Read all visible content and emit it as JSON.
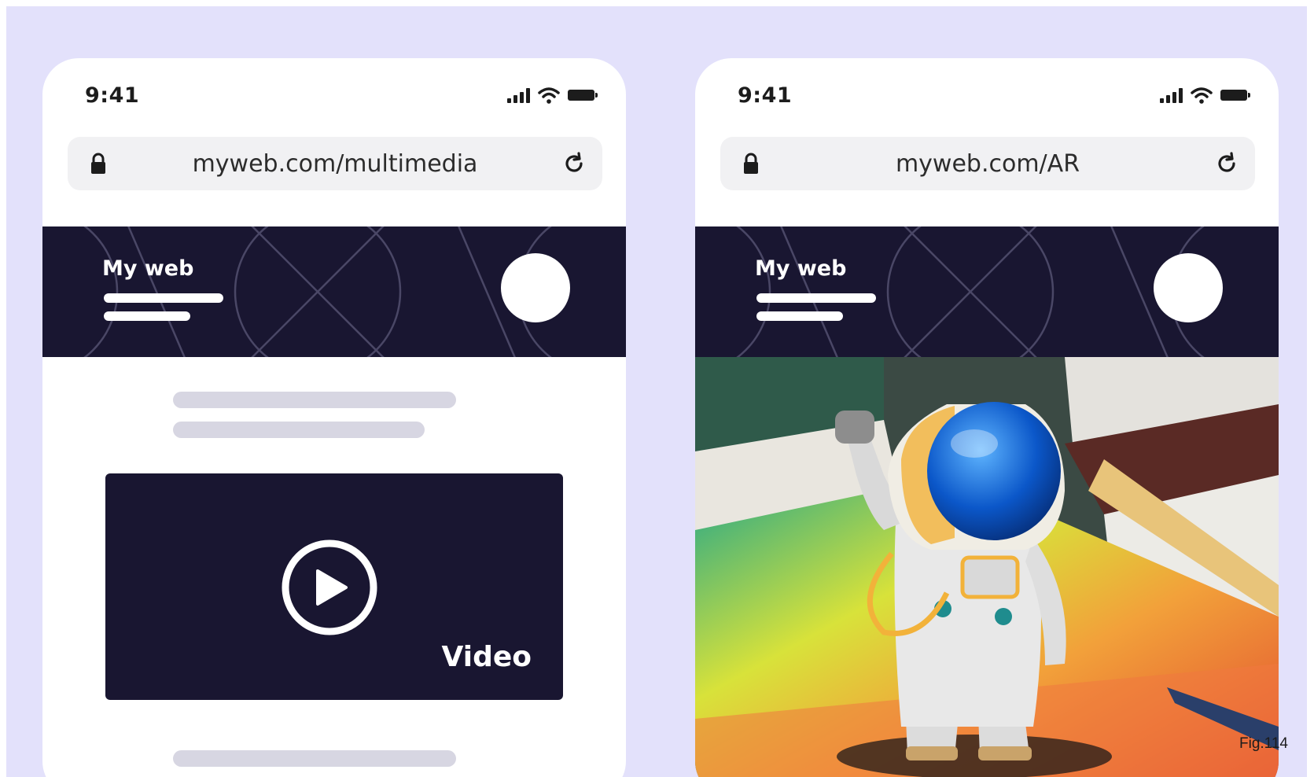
{
  "figure": {
    "caption": "Fig.114"
  },
  "colors": {
    "background": "#e3e1fb",
    "phone": "#ffffff",
    "header": "#191631",
    "skeleton": "#d7d6e2",
    "address_bar": "#f1f1f3"
  },
  "phones": [
    {
      "status": {
        "time": "9:41",
        "icons": [
          "signal-icon",
          "wifi-icon",
          "battery-icon"
        ]
      },
      "address_bar": {
        "url": "myweb.com/multimedia",
        "icons": [
          "lock-icon",
          "reload-icon"
        ]
      },
      "header": {
        "brand": "My web"
      },
      "video": {
        "label": "Video",
        "icon": "play-icon"
      }
    },
    {
      "status": {
        "time": "9:41",
        "icons": [
          "signal-icon",
          "wifi-icon",
          "battery-icon"
        ]
      },
      "address_bar": {
        "url": "myweb.com/AR",
        "icons": [
          "lock-icon",
          "reload-icon"
        ]
      },
      "header": {
        "brand": "My web"
      },
      "ar_view": {
        "subject": "astronaut-figure"
      }
    }
  ]
}
